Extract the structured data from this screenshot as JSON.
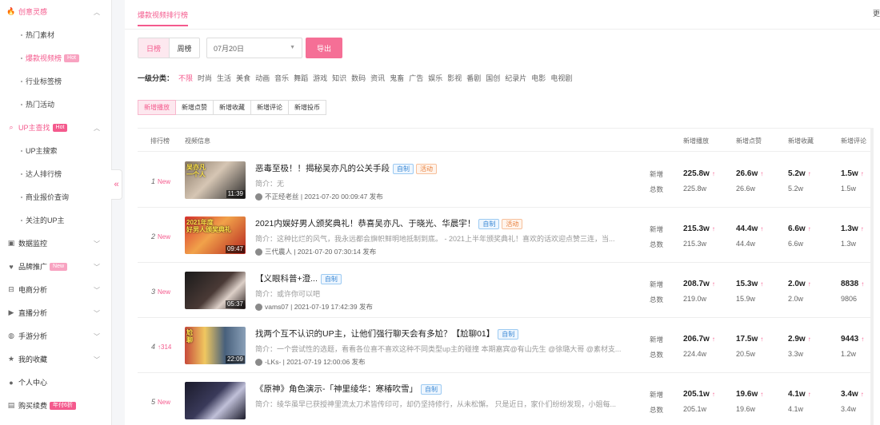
{
  "sidebar": {
    "groups": [
      {
        "label": "创意灵感",
        "icon": "flame-icon",
        "glyph": "🔥",
        "active": true,
        "items": [
          {
            "label": "热门素材",
            "active": false,
            "badge": ""
          },
          {
            "label": "爆款视频榜",
            "active": true,
            "badge": "Hot"
          },
          {
            "label": "行业标签榜",
            "active": false,
            "badge": ""
          },
          {
            "label": "热门活动",
            "active": false,
            "badge": ""
          }
        ]
      },
      {
        "label": "UP主查找",
        "icon": "search-icon",
        "glyph": "⌕",
        "badge": "Hot",
        "active": true,
        "items": [
          {
            "label": "UP主搜索",
            "active": false
          },
          {
            "label": "达人排行榜",
            "active": false
          },
          {
            "label": "商业报价查询",
            "active": false
          },
          {
            "label": "关注的UP主",
            "active": false
          }
        ]
      }
    ],
    "others": [
      {
        "label": "数据监控",
        "icon": "monitor-icon",
        "glyph": "▣",
        "badge": ""
      },
      {
        "label": "品牌推广",
        "icon": "heart-icon",
        "glyph": "♥",
        "badge": "New"
      },
      {
        "label": "电商分析",
        "icon": "shop-icon",
        "glyph": "⊟",
        "badge": ""
      },
      {
        "label": "直播分析",
        "icon": "live-icon",
        "glyph": "▶",
        "badge": ""
      },
      {
        "label": "手游分析",
        "icon": "gamepad-icon",
        "glyph": "◍",
        "badge": ""
      },
      {
        "label": "我的收藏",
        "icon": "star-icon",
        "glyph": "★",
        "badge": ""
      },
      {
        "label": "个人中心",
        "icon": "user-icon",
        "glyph": "●",
        "badge": ""
      },
      {
        "label": "购买续费",
        "icon": "cart-icon",
        "glyph": "▤",
        "badge": "年付6折"
      }
    ],
    "collapse_glyph": "«"
  },
  "header": {
    "tab": "爆款视频排行榜",
    "more": "更"
  },
  "filters": {
    "day": "日榜",
    "week": "周榜",
    "date": "07月20日",
    "export": "导出"
  },
  "categories": {
    "label": "一级分类：",
    "items": [
      "不限",
      "时尚",
      "生活",
      "美食",
      "动画",
      "音乐",
      "舞蹈",
      "游戏",
      "知识",
      "数码",
      "资讯",
      "鬼畜",
      "广告",
      "娱乐",
      "影视",
      "番剧",
      "国创",
      "纪录片",
      "电影",
      "电视剧"
    ]
  },
  "subtabs": [
    "新增播放",
    "新增点赞",
    "新增收藏",
    "新增评论",
    "新增投币"
  ],
  "table": {
    "headers": [
      "排行榜",
      "视频信息",
      "新增播放",
      "新增点赞",
      "新增收藏",
      "新增评论"
    ],
    "label_new": "新增",
    "label_total": "总数",
    "rows": [
      {
        "rank": "1",
        "tag": "New",
        "dur": "11:39",
        "cap": "吴亦凡\n一个人",
        "title": "恶毒至极！！揭秘吴亦凡的公关手段",
        "tags": [
          "自制",
          "活动"
        ],
        "intro": "简介：无",
        "meta": "不正经老丝 | 2021-07-20 00:09:47 发布",
        "plays": [
          "225.8w",
          "225.8w"
        ],
        "likes": [
          "26.6w",
          "26.6w"
        ],
        "favs": [
          "5.2w",
          "5.2w"
        ],
        "comments": [
          "1.5w",
          "1.5w"
        ]
      },
      {
        "rank": "2",
        "tag": "New",
        "dur": "09:47",
        "cap": "2021年度\n好男人颁奖典礼",
        "title": "2021内娱好男人颁奖典礼！恭喜吴亦凡、于晓光、华晨宇！",
        "tags": [
          "自制",
          "活动"
        ],
        "intro": "简介：这种比烂的风气，我永远都会旗帜鲜明地抵制到底。 - 2021上半年颁奖典礼！喜欢的话欢迎点赞三连，当...",
        "meta": "三代農人 | 2021-07-20 07:30:14 发布",
        "plays": [
          "215.3w",
          "215.3w"
        ],
        "likes": [
          "44.4w",
          "44.4w"
        ],
        "favs": [
          "6.6w",
          "6.6w"
        ],
        "comments": [
          "1.3w",
          "1.3w"
        ]
      },
      {
        "rank": "3",
        "tag": "New",
        "dur": "05:37",
        "cap": "",
        "title": "【义眼科普+澄...",
        "tags": [
          "自制"
        ],
        "intro": "简介：或许你可以吧",
        "meta": "vams07 | 2021-07-19 17:42:39 发布",
        "plays": [
          "208.7w",
          "219.0w"
        ],
        "likes": [
          "15.3w",
          "15.9w"
        ],
        "favs": [
          "2.0w",
          "2.0w"
        ],
        "comments": [
          "8838",
          "9806"
        ]
      },
      {
        "rank": "4",
        "tag": "↑314",
        "dur": "22:09",
        "cap": "尬\n聊",
        "title": "找两个互不认识的UP主，让他们强行聊天会有多尬？【尬聊01】",
        "tags": [
          "自制"
        ],
        "intro": "简介：一个尝试性的选题，看看各位喜不喜欢这种不同类型up主的碰撞 本期嘉宾@有山先生 @徐璐大哥 @素材支...",
        "meta": "-LKs- | 2021-07-19 12:00:06 发布",
        "plays": [
          "206.7w",
          "224.4w"
        ],
        "likes": [
          "17.5w",
          "20.5w"
        ],
        "favs": [
          "2.9w",
          "3.3w"
        ],
        "comments": [
          "9443",
          "1.2w"
        ]
      },
      {
        "rank": "5",
        "tag": "New",
        "dur": "",
        "cap": "",
        "title": "《原神》角色演示-「神里绫华：寒椿吹雪」",
        "tags": [
          "自制"
        ],
        "intro": "简介：绫华虽早已获授神里流太刀术皆传印可，却仍坚持修行，从未松懈。 只是近日，家仆们纷纷发现，小姐每...",
        "meta": "",
        "plays": [
          "205.1w",
          "205.1w"
        ],
        "likes": [
          "19.6w",
          "19.6w"
        ],
        "favs": [
          "4.1w",
          "4.1w"
        ],
        "comments": [
          "3.4w",
          "3.4w"
        ]
      }
    ]
  },
  "colors": {
    "accent": "#f45a8d",
    "export_button": "#f56f96"
  }
}
